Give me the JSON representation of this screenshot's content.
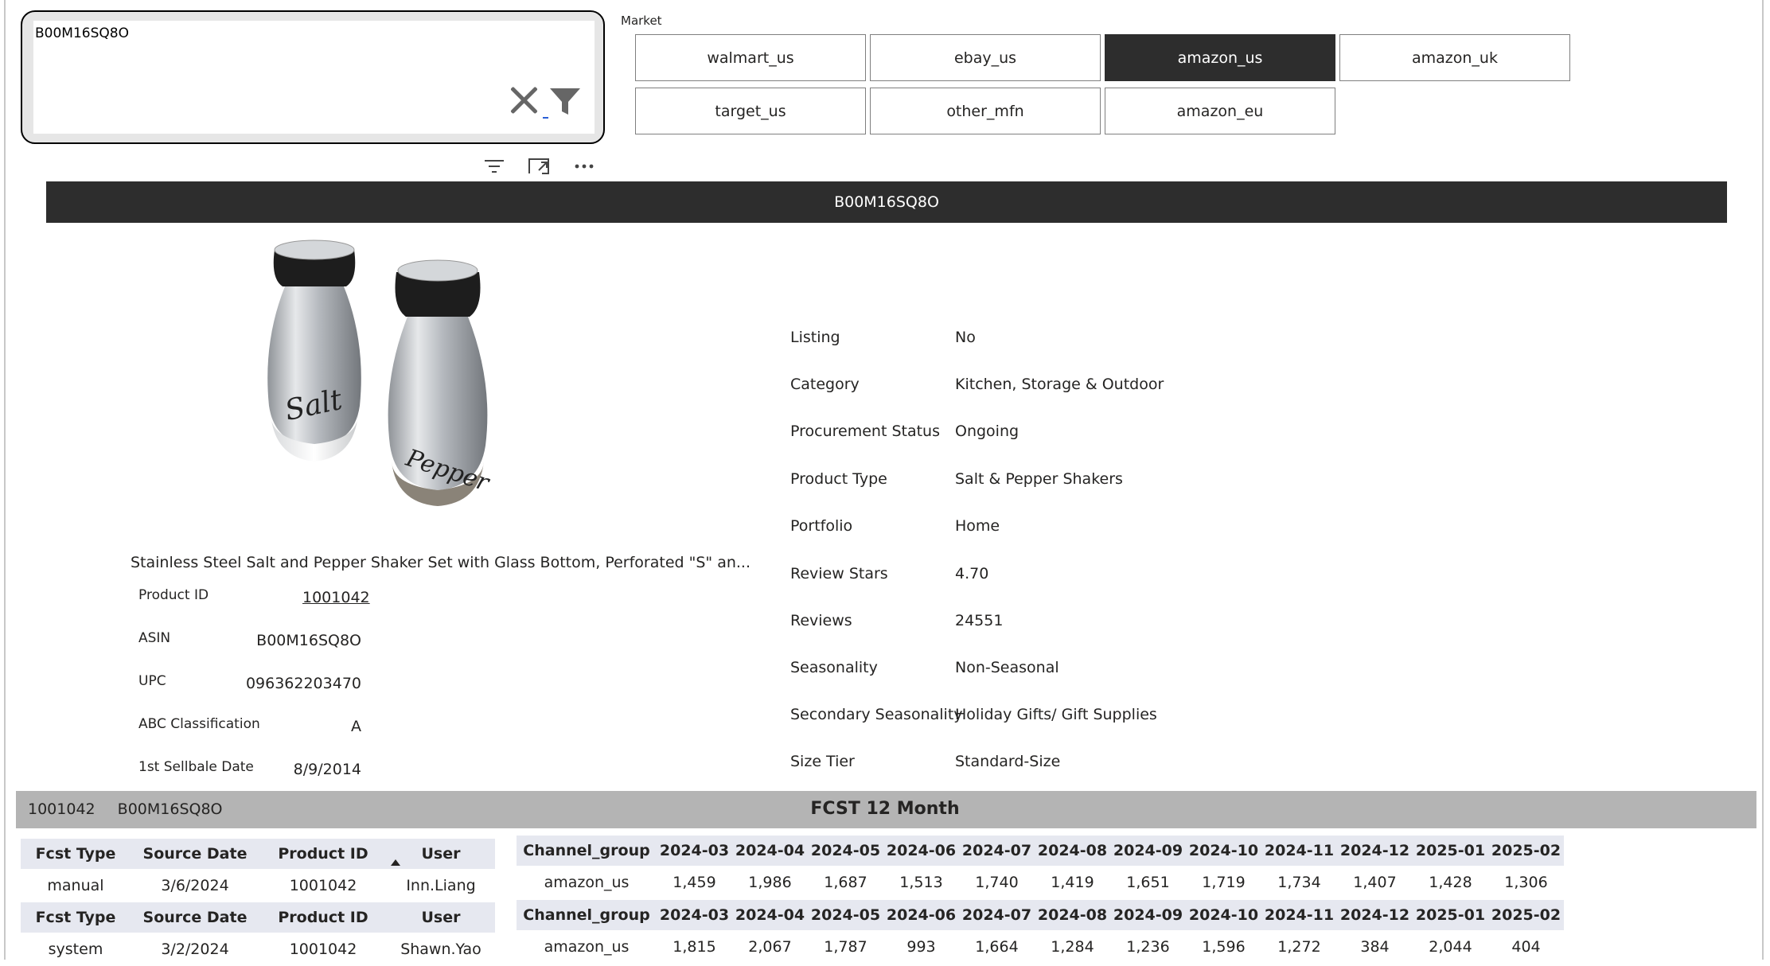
{
  "search": {
    "value": "B00M16SQ8O"
  },
  "market": {
    "label": "Market",
    "options": [
      "walmart_us",
      "ebay_us",
      "amazon_us",
      "amazon_uk",
      "target_us",
      "other_mfn",
      "amazon_eu"
    ],
    "selected": "amazon_us"
  },
  "header": {
    "asin": "B00M16SQ8O"
  },
  "product": {
    "title": "Stainless Steel Salt and Pepper Shaker Set with Glass Bottom, Perforated \"S\" an...",
    "image_labels": {
      "salt": "Salt",
      "pepper": "Pepper"
    },
    "details": [
      {
        "label": "Product ID",
        "value": "1001042"
      },
      {
        "label": "ASIN",
        "value": "B00M16SQ8O"
      },
      {
        "label": "UPC",
        "value": "096362203470"
      },
      {
        "label": "ABC Classification",
        "value": "A"
      },
      {
        "label": "1st Sellbale Date",
        "value": "8/9/2014"
      }
    ]
  },
  "attributes": [
    {
      "label": "Listing",
      "value": "No"
    },
    {
      "label": "Category",
      "value": "Kitchen, Storage & Outdoor"
    },
    {
      "label": "Procurement Status",
      "value": "Ongoing"
    },
    {
      "label": "Product Type",
      "value": "Salt & Pepper Shakers"
    },
    {
      "label": "Portfolio",
      "value": "Home"
    },
    {
      "label": "Review Stars",
      "value": "4.70"
    },
    {
      "label": "Reviews",
      "value": "24551"
    },
    {
      "label": "Seasonality",
      "value": "Non-Seasonal"
    },
    {
      "label": "Secondary Seasonality",
      "value": "Holiday Gifts/ Gift Supplies"
    },
    {
      "label": "Size Tier",
      "value": "Standard-Size"
    }
  ],
  "fcst": {
    "band_product_id": "1001042",
    "band_asin": "B00M16SQ8O",
    "title": "FCST 12 Month",
    "meta_headers": [
      "Fcst Type",
      "Source Date",
      "Product ID",
      "User"
    ],
    "rows_meta": [
      [
        "manual",
        "3/6/2024",
        "1001042",
        "Inn.Liang"
      ],
      [
        "system",
        "3/2/2024",
        "1001042",
        "Shawn.Yao"
      ]
    ],
    "month_headers": [
      "Channel_group",
      "2024-03",
      "2024-04",
      "2024-05",
      "2024-06",
      "2024-07",
      "2024-08",
      "2024-09",
      "2024-10",
      "2024-11",
      "2024-12",
      "2025-01",
      "2025-02"
    ],
    "rows_values": [
      [
        "amazon_us",
        "1,459",
        "1,986",
        "1,687",
        "1,513",
        "1,740",
        "1,419",
        "1,651",
        "1,719",
        "1,734",
        "1,407",
        "1,428",
        "1,306"
      ],
      [
        "amazon_us",
        "1,815",
        "2,067",
        "1,787",
        "993",
        "1,664",
        "1,284",
        "1,236",
        "1,596",
        "1,272",
        "384",
        "2,044",
        "404"
      ]
    ]
  }
}
